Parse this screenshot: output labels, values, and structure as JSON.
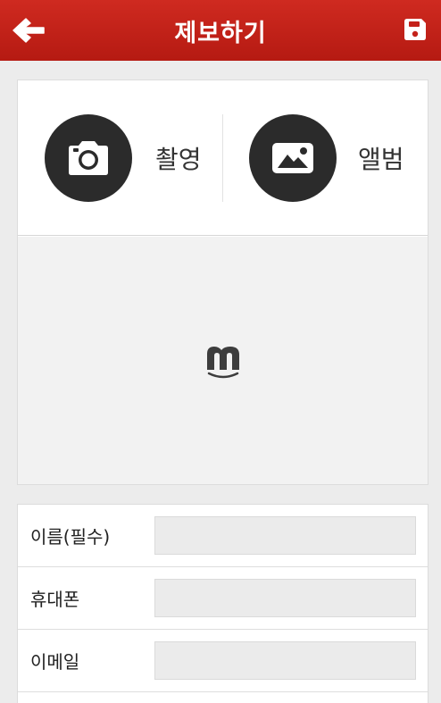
{
  "header": {
    "title": "제보하기",
    "back_icon": "arrow-left-icon",
    "save_icon": "floppy-disk-icon",
    "bg_color": "#c4211a"
  },
  "capture": {
    "camera_label": "촬영",
    "album_label": "앨범",
    "camera_icon": "camera-icon",
    "album_icon": "image-icon"
  },
  "preview": {
    "logo_icon": "m-logo-icon"
  },
  "form": {
    "fields": [
      {
        "label": "이름(필수)",
        "value": ""
      },
      {
        "label": "휴대폰",
        "value": ""
      },
      {
        "label": "이메일",
        "value": ""
      }
    ]
  }
}
